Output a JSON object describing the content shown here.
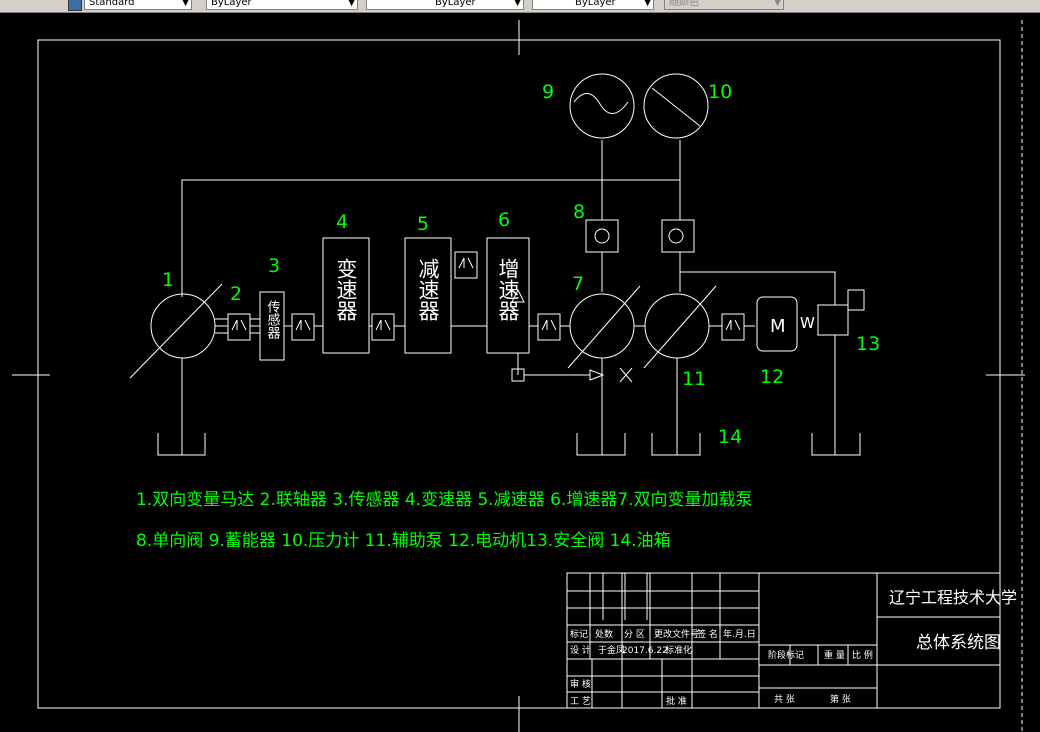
{
  "toolbar": {
    "text_style": "Standard",
    "layer": "ByLayer",
    "linetype": "ByLayer",
    "lineweight": "ByLayer",
    "plot_style": "随颜色"
  },
  "labels": {
    "n1": "1",
    "n2": "2",
    "n3": "3",
    "n4": "4",
    "n5": "5",
    "n6": "6",
    "n7": "7",
    "n8": "8",
    "n9": "9",
    "n10": "10",
    "n11": "11",
    "n12": "12",
    "n13": "13",
    "n14": "14"
  },
  "components": {
    "sensor": "传感器",
    "gearbox": "变速器",
    "reducer": "减速器",
    "speed_up": "增速器",
    "motor": "M",
    "spring": "W"
  },
  "legend": {
    "line1": "1.双向变量马达 2.联轴器 3.传感器 4.变速器 5.减速器 6.增速器7.双向变量加载泵",
    "line2": "8.单向阀 9.蓄能器 10.压力计 11.辅助泵 12.电动机13.安全阀 14.油箱"
  },
  "title_block": {
    "school": "辽宁工程技术大学",
    "drawing_title": "总体系统图",
    "h_mark": "标记",
    "h_count": "处数",
    "h_zone": "分 区",
    "h_docno": "更改文件号",
    "h_sign": "签 名",
    "h_date": "年.月.日",
    "design_label": "设 计",
    "designer": "于金凤",
    "design_date": "2017.6.22",
    "standard_label": "标准化",
    "stage": "阶段标记",
    "weight": "重 量",
    "scale": "比 例",
    "review": "审 核",
    "process": "工 艺",
    "approve": "批 准",
    "sheets_total": "共   张",
    "sheet_no": "第   张"
  },
  "colors": {
    "drawing": "#ffffff",
    "text": "#00ff00",
    "background": "#000000"
  }
}
